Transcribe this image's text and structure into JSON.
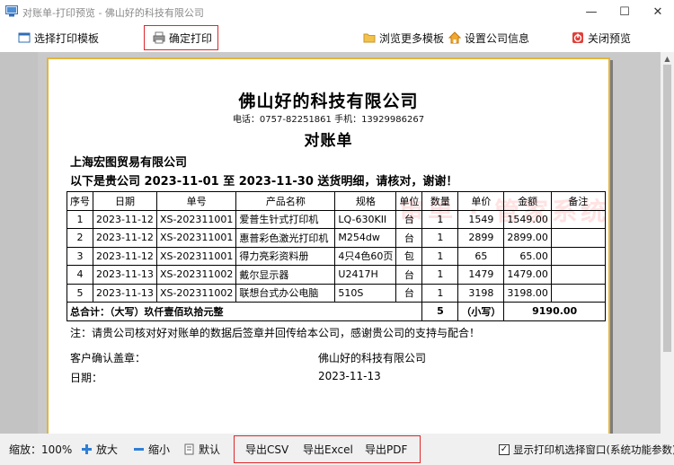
{
  "window": {
    "title": "对账单-打印预览 - 佛山好的科技有限公司",
    "controls": {
      "minimize": "—",
      "maximize": "☐",
      "close": "✕"
    }
  },
  "toolbar": {
    "select_template": "选择打印模板",
    "confirm_print": "确定打印",
    "browse_templates": "浏览更多模板",
    "company_settings": "设置公司信息",
    "close_preview": "关闭预览"
  },
  "document": {
    "company": "佛山好的科技有限公司",
    "contact": "电话：0757-82251861 手机：13929986267",
    "title": "对账单",
    "customer": "上海宏图贸易有限公司",
    "period_line": "以下是贵公司 2023-11-01 至 2023-11-30 送货明细，请核对，谢谢！",
    "watermark": "审单 · 管家系统",
    "table": {
      "headers": [
        "序号",
        "日期",
        "单号",
        "产品名称",
        "规格",
        "单位",
        "数量",
        "单价",
        "金额",
        "备注"
      ],
      "rows": [
        [
          "1",
          "2023-11-12",
          "XS-202311001",
          "爱普生针式打印机",
          "LQ-630KII",
          "台",
          "1",
          "1549",
          "1549.00",
          ""
        ],
        [
          "2",
          "2023-11-12",
          "XS-202311001",
          "惠普彩色激光打印机",
          "M254dw",
          "台",
          "1",
          "2899",
          "2899.00",
          ""
        ],
        [
          "3",
          "2023-11-12",
          "XS-202311001",
          "得力亮彩资料册",
          "4只4色60页",
          "包",
          "1",
          "65",
          "65.00",
          ""
        ],
        [
          "4",
          "2023-11-13",
          "XS-202311002",
          "戴尔显示器",
          "U2417H",
          "台",
          "1",
          "1479",
          "1479.00",
          ""
        ],
        [
          "5",
          "2023-11-13",
          "XS-202311002",
          "联想台式办公电脑",
          "510S",
          "台",
          "1",
          "3198",
          "3198.00",
          ""
        ]
      ],
      "total_label": "总合计：（大写）玖仟壹佰玖拾元整",
      "total_qty": "5",
      "total_lower_label": "（小写）",
      "total_amount": "9190.00"
    },
    "note": "注：请贵公司核对好对账单的数据后签章并回传给本公司，感谢贵公司的支持与配合！",
    "stamp_label": "客户确认盖章：",
    "stamp_company": "佛山好的科技有限公司",
    "date_label": "日期：",
    "date_value": "2023-11-13"
  },
  "bottombar": {
    "zoom_text": "缩放：100%",
    "zoom_in": "放大",
    "zoom_out": "缩小",
    "default": "默认",
    "export_csv": "导出CSV",
    "export_excel": "导出Excel",
    "export_pdf": "导出PDF",
    "show_printer_dialog": "显示打印机选择窗口(系统功能参数)",
    "show_printer_dialog_checked": true
  },
  "colors": {
    "highlight_box": "#e0262a",
    "paper_border": "#e3b53d",
    "watermark": "#ff9696"
  }
}
